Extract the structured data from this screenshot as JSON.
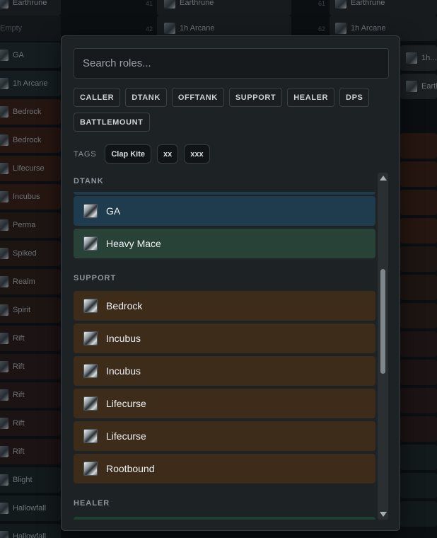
{
  "background": {
    "left_rows": [
      "Earthrune",
      "Empty",
      "GA",
      "1h Arcane",
      "Bedrock",
      "Bedrock",
      "Lifecurse",
      "Incubus",
      "Perma",
      "Spiked",
      "Realm",
      "Spirit",
      "Rift",
      "Rift",
      "Rift",
      "Rift",
      "Rift",
      "Blight",
      "Hallowfall",
      "Hallowfall"
    ],
    "mid_rows": [
      {
        "num": "41",
        "label": "Earthrune"
      },
      {
        "num": "42",
        "label": "1h Arcane"
      }
    ],
    "right_rows": [
      {
        "num": "61",
        "label": "Earthrune"
      },
      {
        "num": "62",
        "label": "1h Arcane"
      },
      {
        "num": "",
        "label": "1h..."
      },
      {
        "num": "",
        "label": "Earth..."
      }
    ]
  },
  "modal": {
    "search_placeholder": "Search roles...",
    "role_filters": [
      "CALLER",
      "DTANK",
      "OFFTANK",
      "SUPPORT",
      "HEALER",
      "DPS",
      "BATTLEMOUNT"
    ],
    "tags_label": "TAGS",
    "tags": [
      "Clap Kite",
      "xx",
      "xxx"
    ],
    "groups": [
      {
        "title": "DTANK",
        "items": [
          {
            "label": "GA",
            "style": "dtank-blue",
            "icon": "weapon-icon"
          },
          {
            "label": "Heavy Mace",
            "style": "dtank-green",
            "icon": "mace-icon"
          }
        ]
      },
      {
        "title": "SUPPORT",
        "items": [
          {
            "label": "Bedrock",
            "style": "support",
            "icon": "staff-icon"
          },
          {
            "label": "Incubus",
            "style": "support",
            "icon": "staff-icon"
          },
          {
            "label": "Incubus",
            "style": "support",
            "icon": "staff-icon"
          },
          {
            "label": "Lifecurse",
            "style": "support",
            "icon": "staff-icon"
          },
          {
            "label": "Lifecurse",
            "style": "support",
            "icon": "staff-icon"
          },
          {
            "label": "Rootbound",
            "style": "support",
            "icon": "staff-icon"
          }
        ]
      },
      {
        "title": "HEALER",
        "items": []
      }
    ]
  },
  "colors": {
    "dtank_blue": "#1e3c4e",
    "dtank_green": "#284238",
    "support": "#3d2c1a",
    "healer": "#1f4030"
  }
}
